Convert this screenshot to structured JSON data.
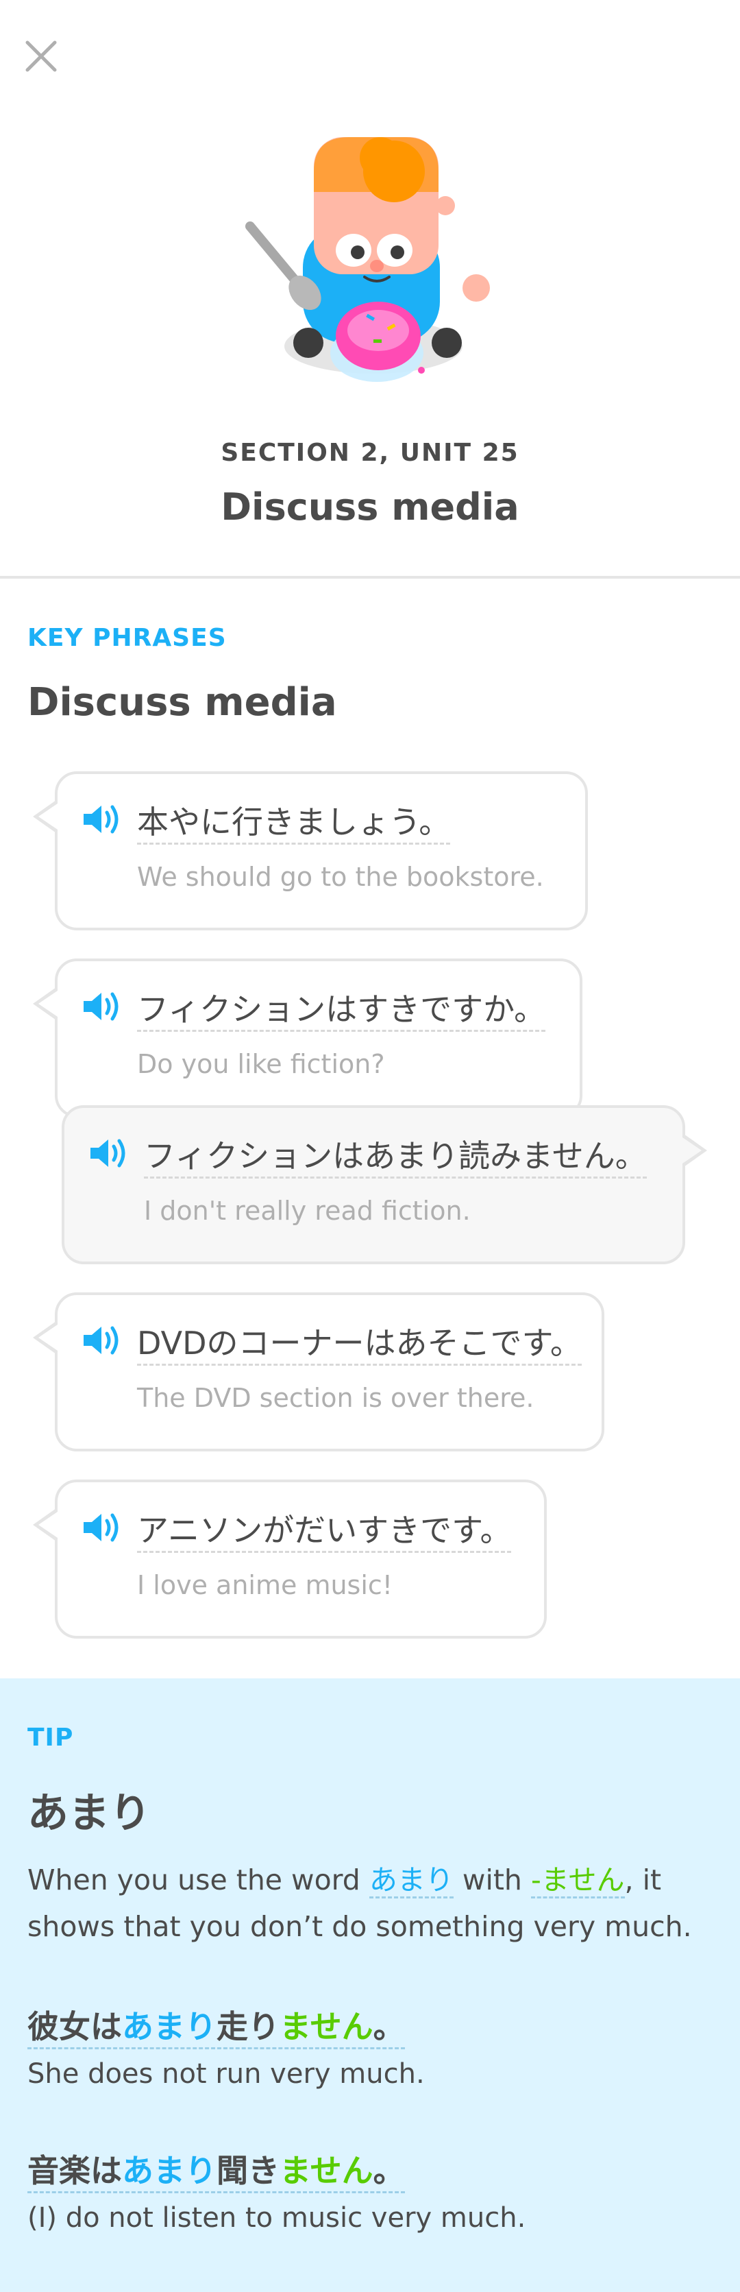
{
  "header": {
    "section_label": "SECTION 2, UNIT 25",
    "unit_title": "Discuss media"
  },
  "key_phrases": {
    "label": "KEY PHRASES",
    "title": "Discuss media",
    "phrases": [
      {
        "side": "left",
        "japanese": "本やに行きましょう。",
        "english": "We should go to the bookstore."
      },
      {
        "side": "left",
        "japanese": "フィクションはすきですか。",
        "english": "Do you like fiction?"
      },
      {
        "side": "right",
        "japanese": "フィクションはあまり読みません。",
        "english": "I don't really read fiction."
      },
      {
        "side": "left",
        "japanese": "DVDのコーナーはあそこです。",
        "english": "The DVD section is over there."
      },
      {
        "side": "left",
        "japanese": "アニソンがだいすきです。",
        "english": "I love anime music!"
      }
    ]
  },
  "tip": {
    "label": "TIP",
    "title": "あまり",
    "body_part1": "When you use the word ",
    "body_word1": "あまり",
    "body_part2": " with ",
    "body_word2": "-ません",
    "body_part3": ", it shows that you don’t do something very much.",
    "examples": [
      {
        "jp_a": "彼女は",
        "jp_b": "あまり",
        "jp_c": "走り",
        "jp_d": "ません",
        "jp_e": "。",
        "english": "She does not run very much."
      },
      {
        "jp_a": "音楽は",
        "jp_b": "あまり",
        "jp_c": "聞き",
        "jp_d": "ません",
        "jp_e": "。",
        "english": "(I) do not listen to music very much."
      }
    ]
  },
  "colors": {
    "accent_blue": "#1cb0f6",
    "accent_green": "#58cc02",
    "tip_background": "#ddf4ff"
  },
  "icons": [
    "close-icon",
    "speaker-icon",
    "character-illustration"
  ]
}
